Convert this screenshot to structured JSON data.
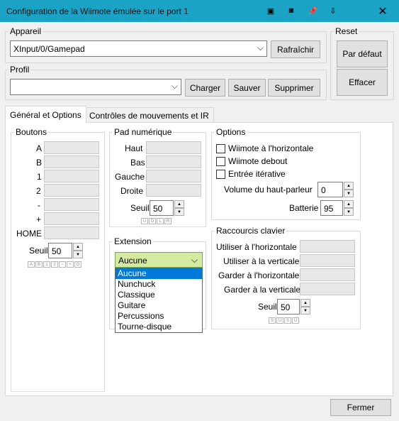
{
  "window": {
    "title": "Configuration de la Wiimote émulée sur le port 1"
  },
  "device": {
    "group_label": "Appareil",
    "selected": "XInput/0/Gamepad",
    "refresh_label": "Rafraîchir"
  },
  "reset": {
    "group_label": "Reset",
    "default_label": "Par défaut",
    "clear_label": "Effacer"
  },
  "profile": {
    "group_label": "Profil",
    "selected": "",
    "load_label": "Charger",
    "save_label": "Sauver",
    "delete_label": "Supprimer"
  },
  "tabs": [
    {
      "label": "Général et Options"
    },
    {
      "label": "Contrôles de mouvements et IR"
    }
  ],
  "buttons": {
    "group_label": "Boutons",
    "items": [
      "A",
      "B",
      "1",
      "2",
      "-",
      "+",
      "HOME"
    ],
    "threshold_label": "Seuil",
    "threshold_value": "50",
    "chips": [
      "A",
      "B",
      "1",
      "2",
      "-",
      "+",
      "O"
    ]
  },
  "dpad": {
    "group_label": "Pad numérique",
    "items": [
      "Haut",
      "Bas",
      "Gauche",
      "Droite"
    ],
    "threshold_label": "Seuil",
    "threshold_value": "50",
    "chips": [
      "U",
      "D",
      "L",
      "R"
    ]
  },
  "options": {
    "group_label": "Options",
    "sideways": "Wiimote à l'horizontale",
    "upright": "Wiimote debout",
    "iterative": "Entrée itérative",
    "speaker_label": "Volume du haut-parleur",
    "speaker_value": "0",
    "battery_label": "Batterie",
    "battery_value": "95"
  },
  "extension": {
    "group_label": "Extension",
    "selected": "Aucune",
    "options": [
      "Aucune",
      "Nunchuck",
      "Classique",
      "Guitare",
      "Percussions",
      "Tourne-disque"
    ]
  },
  "hotkeys": {
    "group_label": "Raccourcis clavier",
    "items": [
      "Utiliser à l'horizontale",
      "Utiliser à la verticale",
      "Garder à l'horizontale",
      "Garder à la verticale"
    ],
    "threshold_label": "Seuil",
    "threshold_value": "50",
    "chips": [
      "S",
      "U",
      "S",
      "U"
    ]
  },
  "footer": {
    "close_label": "Fermer"
  }
}
